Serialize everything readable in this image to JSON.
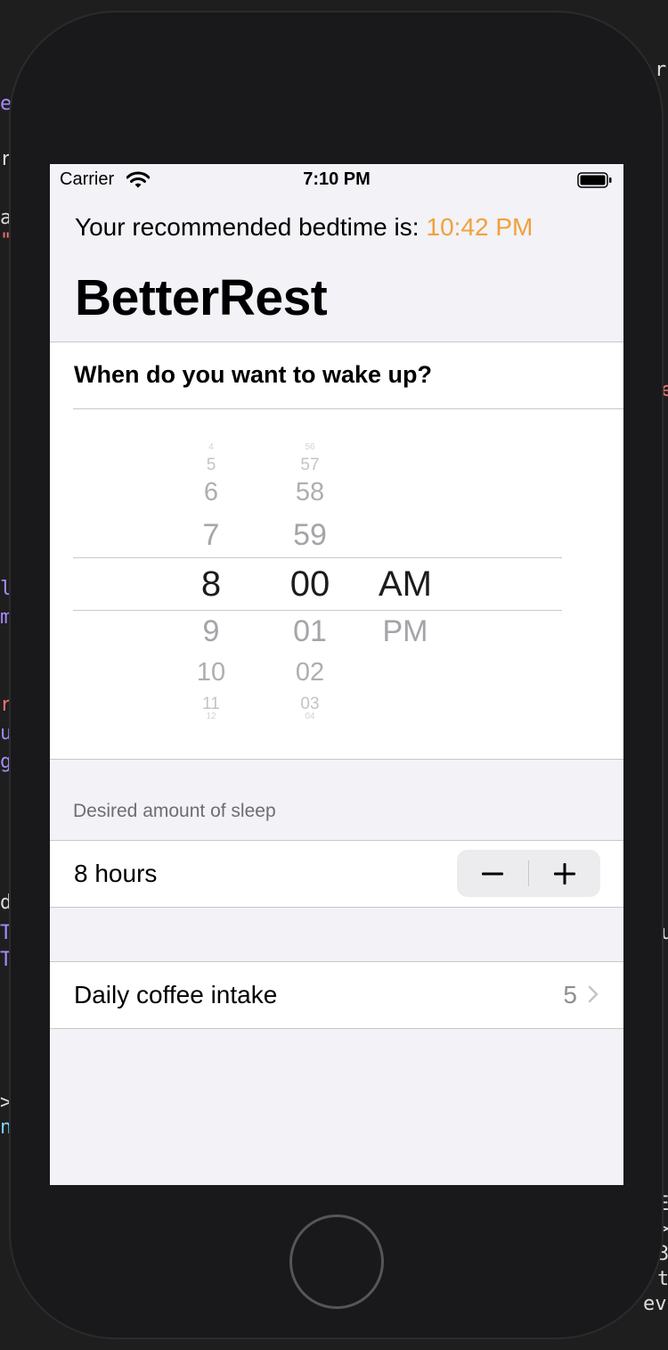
{
  "background": {
    "left_fragments": [
      "e",
      "r",
      "a",
      "\"",
      "l",
      "m",
      "r",
      "u",
      "g",
      "d",
      "T",
      "T",
      ">",
      "n"
    ],
    "right_fragments": [
      "r",
      "e",
      "u",
      "E",
      ">",
      "3",
      "t",
      "ev"
    ]
  },
  "status_bar": {
    "carrier": "Carrier",
    "time": "7:10 PM"
  },
  "bedtime": {
    "label": "Your recommended bedtime is:",
    "value": "10:42 PM"
  },
  "nav": {
    "title": "BetterRest"
  },
  "wake_section": {
    "question": "When do you want to wake up?",
    "picker": {
      "hours": [
        "4",
        "5",
        "6",
        "7",
        "8",
        "9",
        "10",
        "11",
        "12"
      ],
      "minutes": [
        "56",
        "57",
        "58",
        "59",
        "00",
        "01",
        "02",
        "03",
        "04"
      ],
      "periods": [
        "AM",
        "PM"
      ],
      "selected": {
        "hour": "8",
        "minute": "00",
        "period": "AM"
      }
    }
  },
  "sleep_section": {
    "header": "Desired amount of sleep",
    "value_text": "8 hours",
    "stepper": {
      "decrement": "−",
      "increment": "+"
    }
  },
  "coffee_section": {
    "label": "Daily coffee intake",
    "value": "5"
  },
  "colors": {
    "accent": "#f0a13a",
    "grouped_background": "#f2f2f7",
    "secondary_label": "#8e8e93"
  }
}
